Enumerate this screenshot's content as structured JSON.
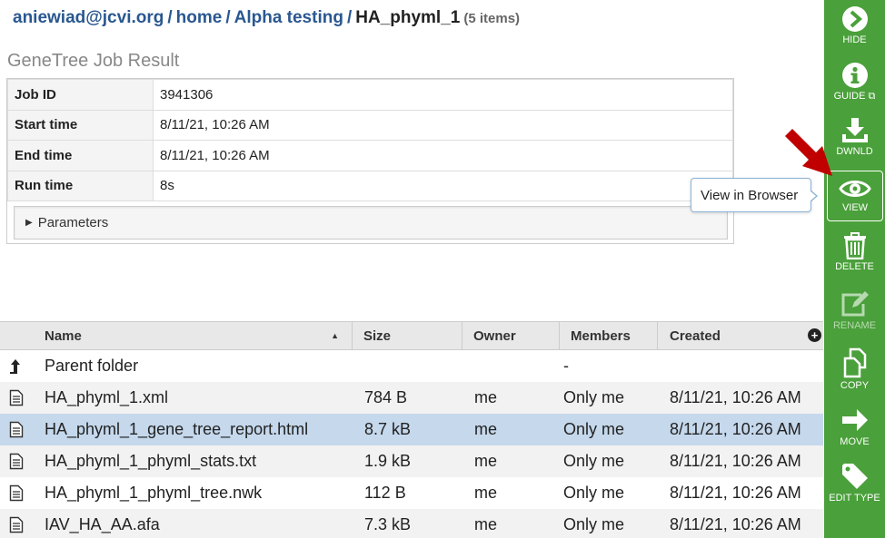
{
  "breadcrumb": {
    "user": "aniewiad@jcvi.org",
    "home": "home",
    "folder": "Alpha testing",
    "current": "HA_phyml_1",
    "count": "(5 items)"
  },
  "result_title": "GeneTree Job Result",
  "job": {
    "rows": [
      {
        "key": "Job ID",
        "value": "3941306"
      },
      {
        "key": "Start time",
        "value": "8/11/21, 10:26 AM"
      },
      {
        "key": "End time",
        "value": "8/11/21, 10:26 AM"
      },
      {
        "key": "Run time",
        "value": "8s"
      }
    ],
    "parameters_label": "Parameters"
  },
  "grid": {
    "headers": {
      "name": "Name",
      "size": "Size",
      "owner": "Owner",
      "members": "Members",
      "created": "Created"
    },
    "parent": {
      "name": "Parent folder",
      "members": "-"
    },
    "rows": [
      {
        "name": "HA_phyml_1.xml",
        "size": "784 B",
        "owner": "me",
        "members": "Only me",
        "created": "8/11/21, 10:26 AM"
      },
      {
        "name": "HA_phyml_1_gene_tree_report.html",
        "size": "8.7 kB",
        "owner": "me",
        "members": "Only me",
        "created": "8/11/21, 10:26 AM"
      },
      {
        "name": "HA_phyml_1_phyml_stats.txt",
        "size": "1.9 kB",
        "owner": "me",
        "members": "Only me",
        "created": "8/11/21, 10:26 AM"
      },
      {
        "name": "HA_phyml_1_phyml_tree.nwk",
        "size": "112 B",
        "owner": "me",
        "members": "Only me",
        "created": "8/11/21, 10:26 AM"
      },
      {
        "name": "IAV_HA_AA.afa",
        "size": "7.3 kB",
        "owner": "me",
        "members": "Only me",
        "created": "8/11/21, 10:26 AM"
      }
    ],
    "selected_row": "HA_phyml_1_gene_tree_report.html"
  },
  "actions": {
    "hide": "HIDE",
    "guide": "GUIDE",
    "download": "DWNLD",
    "view": "VIEW",
    "delete": "DELETE",
    "rename": "RENAME",
    "copy": "COPY",
    "move": "MOVE",
    "edit_type": "EDIT TYPE"
  },
  "tooltip": "View in Browser",
  "colors": {
    "action_bar": "#4aa03a",
    "link": "#2a5790",
    "selected_row": "#c5d8ec",
    "annotation_arrow": "#c00000"
  }
}
